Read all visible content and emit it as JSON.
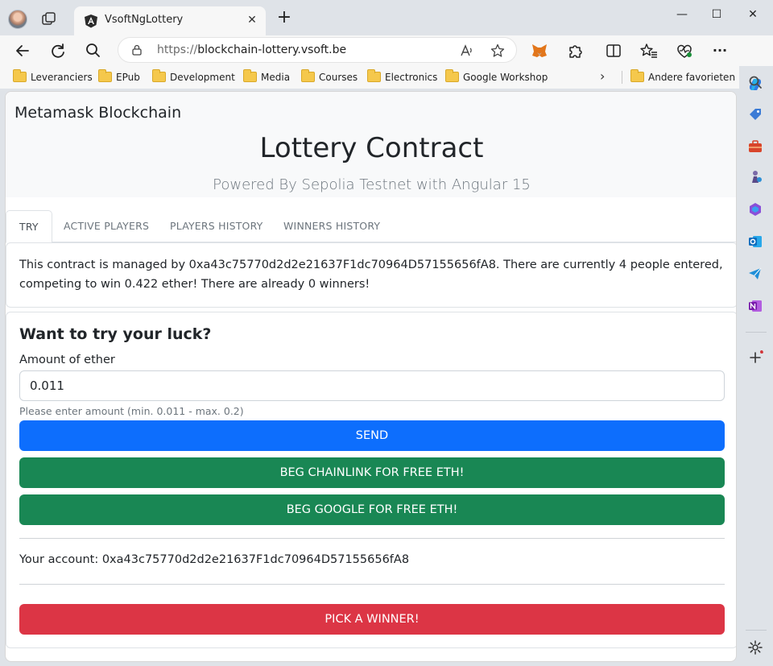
{
  "browser": {
    "tab_title": "VsoftNgLottery",
    "tab_close": "✕",
    "new_tab": "+",
    "url_protocol": "https://",
    "url_host": "blockchain-lottery.vsoft.be",
    "window_controls": {
      "minimize": "—",
      "maximize": "☐",
      "close": "✕"
    }
  },
  "bookmarks": [
    {
      "label": "Leveranciers"
    },
    {
      "label": "EPub"
    },
    {
      "label": "Development"
    },
    {
      "label": "Media"
    },
    {
      "label": "Courses"
    },
    {
      "label": "Electronics"
    },
    {
      "label": "Google Workshop"
    },
    {
      "label": "Andere favorieten"
    }
  ],
  "page": {
    "brand": "Metamask Blockchain",
    "title": "Lottery Contract",
    "subtitle": "Powered By Sepolia Testnet with Angular 15",
    "tabs": [
      {
        "label": "TRY"
      },
      {
        "label": "ACTIVE PLAYERS"
      },
      {
        "label": "PLAYERS HISTORY"
      },
      {
        "label": "WINNERS HISTORY"
      }
    ],
    "info": "This contract is managed by 0xa43c75770d2d2e21637F1dc70964D57155656fA8. There are currently 4 people entered, competing to win 0.422 ether! There are already 0 winners!",
    "form": {
      "heading": "Want to try your luck?",
      "amount_label": "Amount of ether",
      "amount_value": "0.011",
      "help": "Please enter amount (min. 0.011 - max. 0.2)",
      "send": "SEND",
      "beg_chainlink": "BEG CHAINLINK FOR FREE ETH!",
      "beg_google": "BEG GOOGLE FOR FREE ETH!",
      "account": "Your account: 0xa43c75770d2d2e21637F1dc70964D57155656fA8",
      "pick_winner": "PICK A WINNER!"
    }
  },
  "colors": {
    "primary": "#0d6efd",
    "success": "#198754",
    "danger": "#dc3545"
  }
}
